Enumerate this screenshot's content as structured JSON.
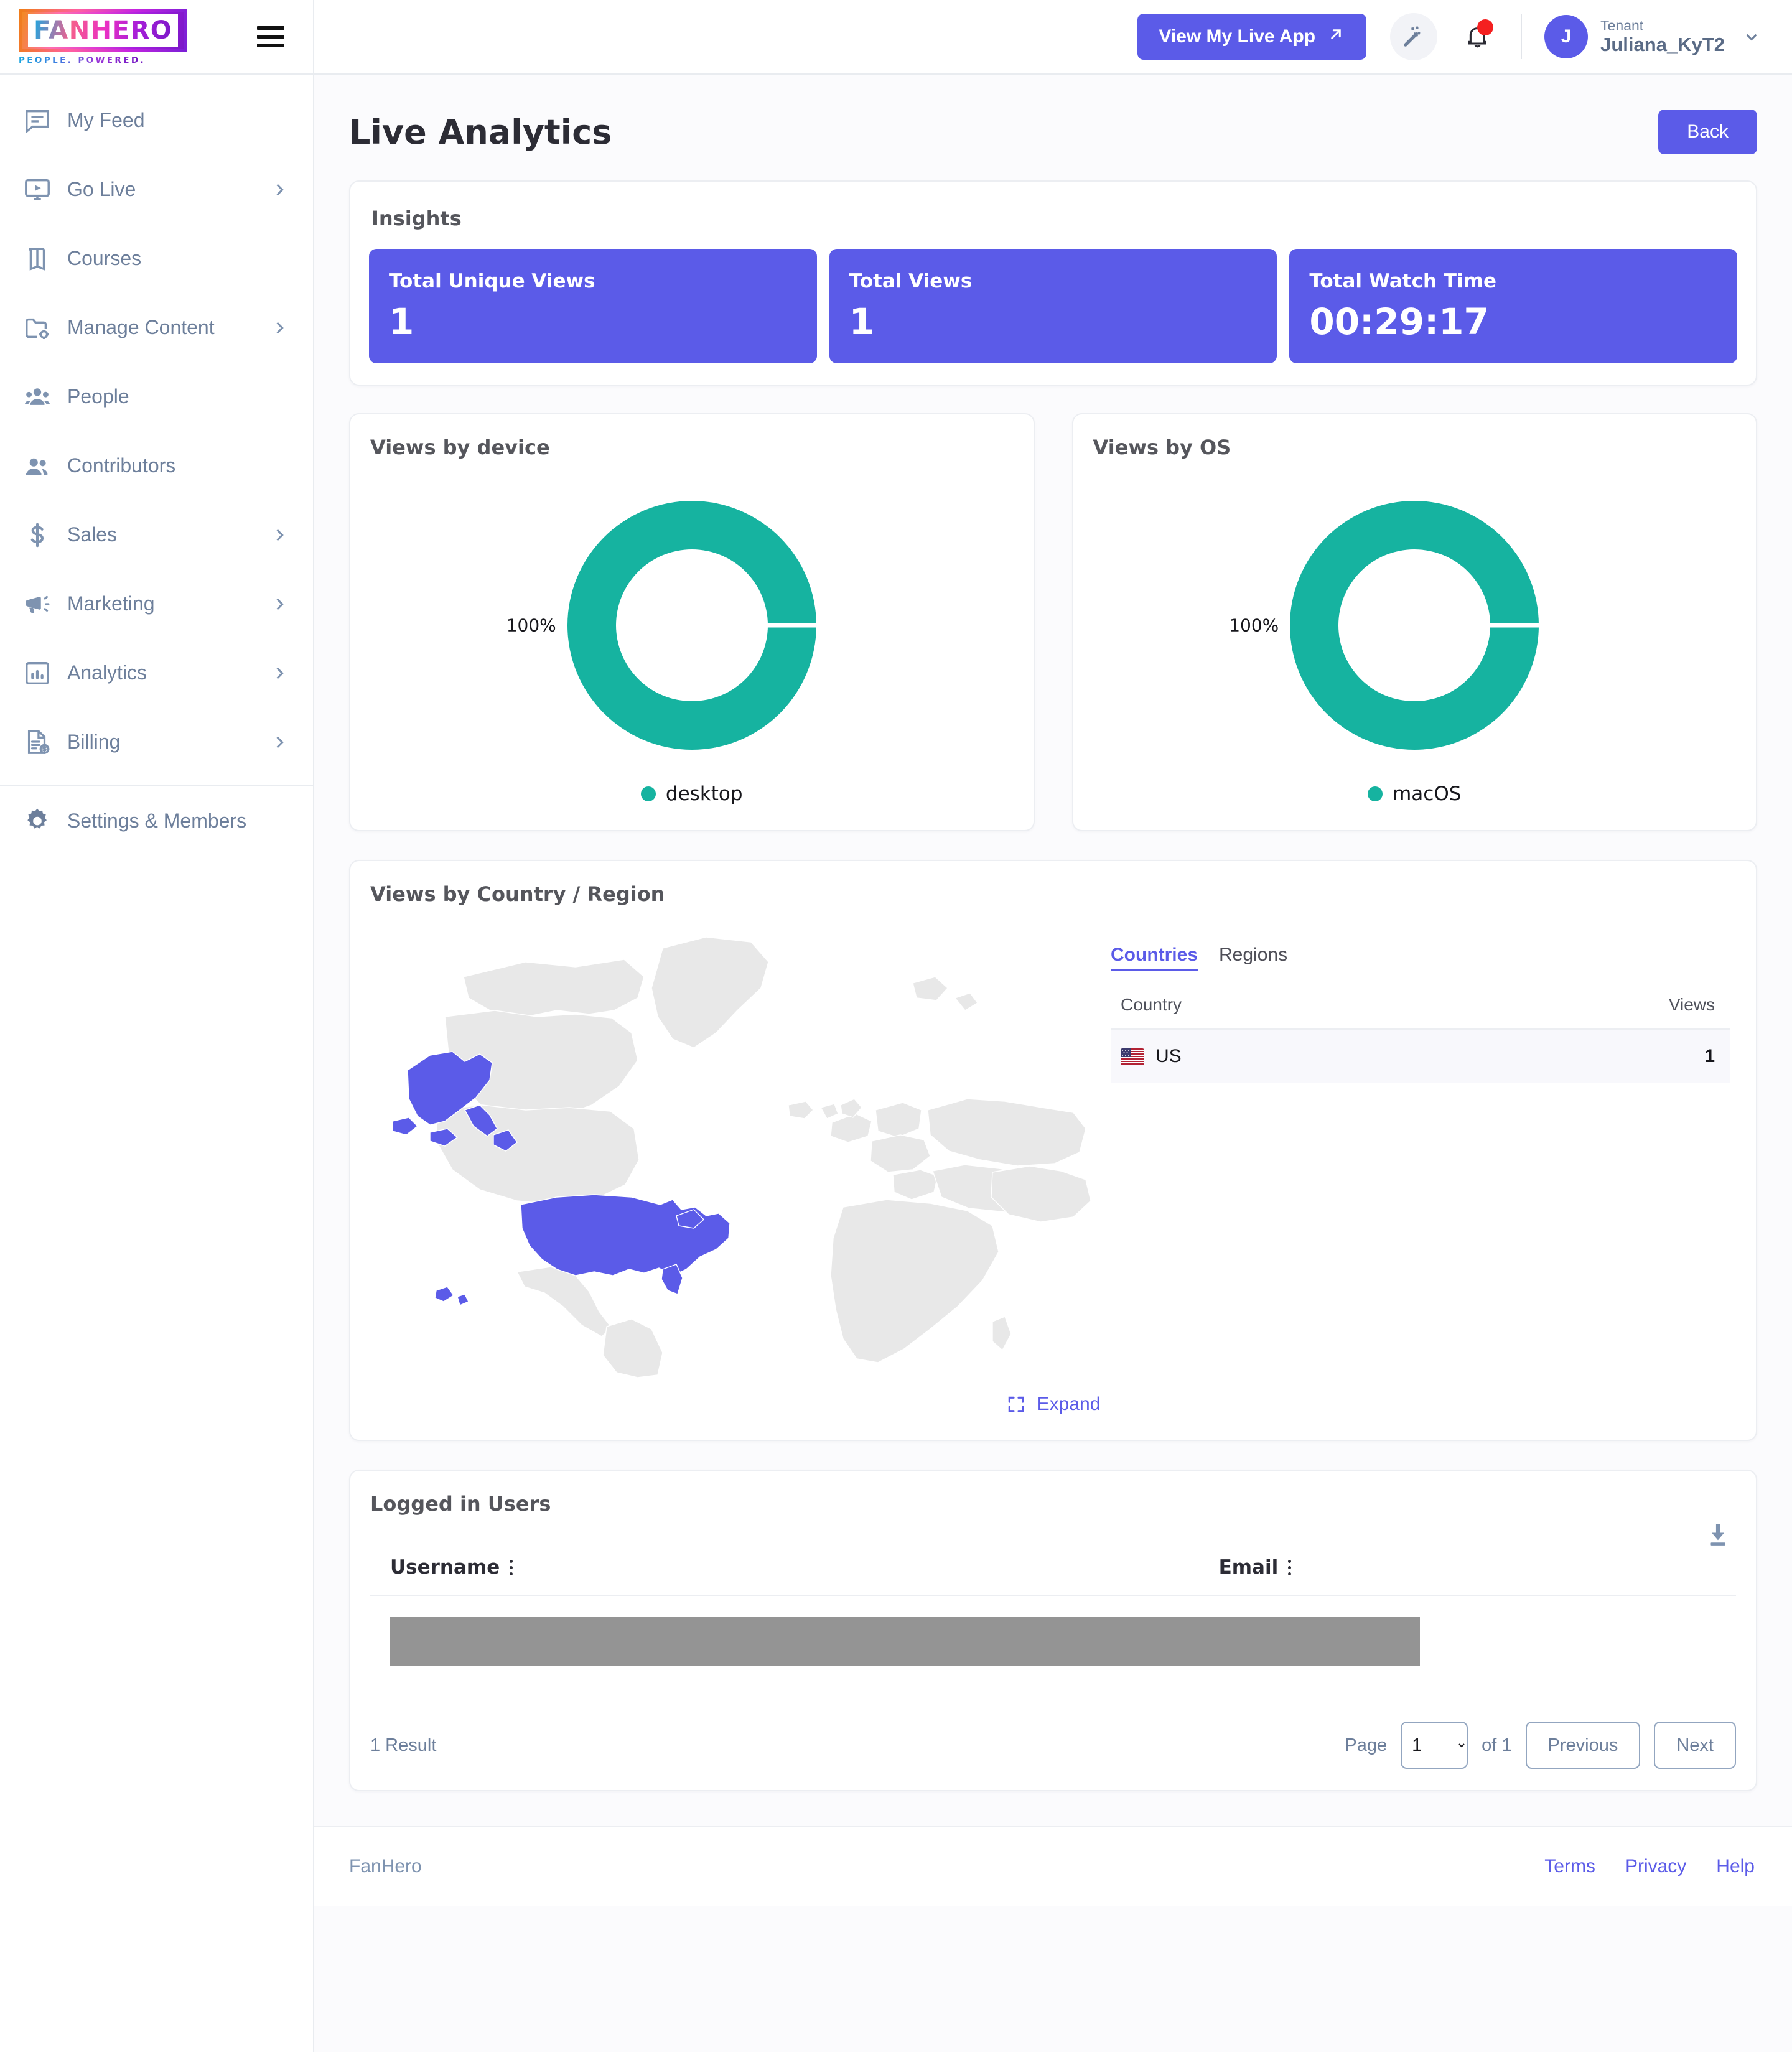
{
  "brand": {
    "logo_text": "FANHERO",
    "logo_tagline": "PEOPLE. POWERED.",
    "accent_purple": "#5b5be8",
    "accent_teal": "#16b3a0",
    "muted_blue": "#6d7f9b"
  },
  "sidebar": {
    "items": [
      {
        "label": "My Feed",
        "icon": "feed-icon",
        "chevron": false
      },
      {
        "label": "Go Live",
        "icon": "go-live-icon",
        "chevron": true
      },
      {
        "label": "Courses",
        "icon": "courses-icon",
        "chevron": false
      },
      {
        "label": "Manage Content",
        "icon": "manage-content-icon",
        "chevron": true
      },
      {
        "label": "People",
        "icon": "people-icon",
        "chevron": false
      },
      {
        "label": "Contributors",
        "icon": "contributors-icon",
        "chevron": false
      },
      {
        "label": "Sales",
        "icon": "dollar-icon",
        "chevron": true
      },
      {
        "label": "Marketing",
        "icon": "megaphone-icon",
        "chevron": true
      },
      {
        "label": "Analytics",
        "icon": "analytics-icon",
        "chevron": true
      },
      {
        "label": "Billing",
        "icon": "billing-icon",
        "chevron": true
      }
    ],
    "settings": {
      "label": "Settings & Members",
      "icon": "gear-icon"
    }
  },
  "topbar": {
    "live_app_label": "View My Live App",
    "magic_icon": "magic-wand-icon",
    "bell_icon": "notification-bell-icon",
    "has_notification": true,
    "user": {
      "avatar_initial": "J",
      "role": "Tenant",
      "name": "Juliana_KyT2"
    }
  },
  "page": {
    "title": "Live Analytics",
    "back_label": "Back"
  },
  "insights": {
    "title": "Insights",
    "stats": [
      {
        "label": "Total Unique Views",
        "value": "1"
      },
      {
        "label": "Total Views",
        "value": "1"
      },
      {
        "label": "Total Watch Time",
        "value": "00:29:17"
      }
    ]
  },
  "device_chart": {
    "title": "Views by device",
    "percent_label": "100%",
    "legend_label": "desktop"
  },
  "os_chart": {
    "title": "Views by OS",
    "percent_label": "100%",
    "legend_label": "macOS"
  },
  "country": {
    "title": "Views by Country / Region",
    "tabs": [
      {
        "label": "Countries",
        "active": true
      },
      {
        "label": "Regions",
        "active": false
      }
    ],
    "columns": {
      "country": "Country",
      "views": "Views"
    },
    "rows": [
      {
        "flag": "us-flag-icon",
        "country": "US",
        "views": "1"
      }
    ],
    "expand_label": "Expand",
    "expand_icon": "expand-icon"
  },
  "users": {
    "title": "Logged in Users",
    "download_icon": "download-icon",
    "columns": [
      {
        "label": "Username"
      },
      {
        "label": "Email"
      }
    ],
    "rows": [
      {
        "redacted": true
      }
    ],
    "result_count": "1 Result",
    "pagination": {
      "page_label": "Page",
      "page_value": "1",
      "page_options": [
        "1"
      ],
      "of_label": "of 1",
      "previous_label": "Previous",
      "next_label": "Next"
    }
  },
  "footer": {
    "brand": "FanHero",
    "links": [
      "Terms",
      "Privacy",
      "Help"
    ]
  },
  "chart_data": [
    {
      "type": "pie",
      "title": "Views by device",
      "categories": [
        "desktop"
      ],
      "values": [
        100
      ],
      "value_unit": "%",
      "labels": [
        "100%"
      ],
      "colors": [
        "#16b3a0"
      ],
      "legend_position": "bottom",
      "donut": true
    },
    {
      "type": "pie",
      "title": "Views by OS",
      "categories": [
        "macOS"
      ],
      "values": [
        100
      ],
      "value_unit": "%",
      "labels": [
        "100%"
      ],
      "colors": [
        "#16b3a0"
      ],
      "legend_position": "bottom",
      "donut": true
    },
    {
      "type": "table",
      "title": "Views by Country / Region",
      "columns": [
        "Country",
        "Views"
      ],
      "rows": [
        [
          "US",
          1
        ]
      ],
      "map_highlight": [
        "US"
      ],
      "map_highlight_color": "#5b5be8",
      "map_base_color": "#e8e8e8"
    }
  ]
}
